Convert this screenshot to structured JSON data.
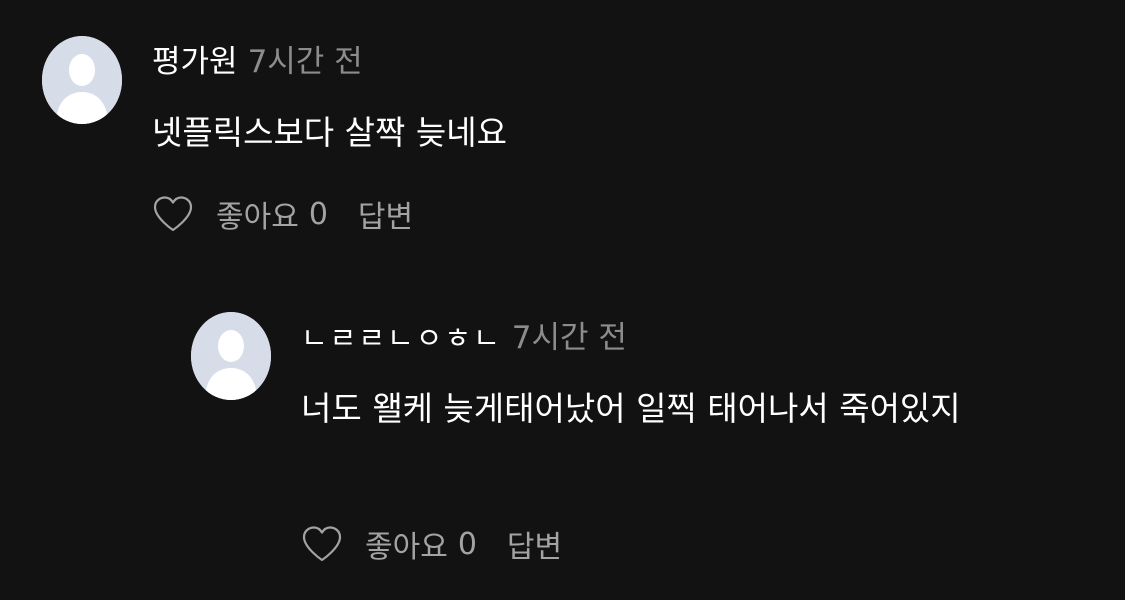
{
  "colors": {
    "background": "#121212",
    "text_primary": "#ffffff",
    "text_secondary": "#8c8c8c",
    "action_text": "#a3a3a3",
    "avatar_bg": "#d7dde8"
  },
  "comments": [
    {
      "author": "평가원",
      "time": "7시간 전",
      "text": "넷플릭스보다 살짝 늦네요",
      "like_label": "좋아요",
      "like_count": "0",
      "reply_label": "답변",
      "avatar_icon": "default-user-icon",
      "like_icon": "heart-outline-icon"
    },
    {
      "author": "ㄴㄹㄹㄴㅇㅎㄴ",
      "time": "7시간 전",
      "text": "너도 왤케 늦게태어났어 일찍 태어나서 죽어있지",
      "like_label": "좋아요",
      "like_count": "0",
      "reply_label": "답변",
      "avatar_icon": "default-user-icon",
      "like_icon": "heart-outline-icon",
      "is_reply": true
    }
  ]
}
